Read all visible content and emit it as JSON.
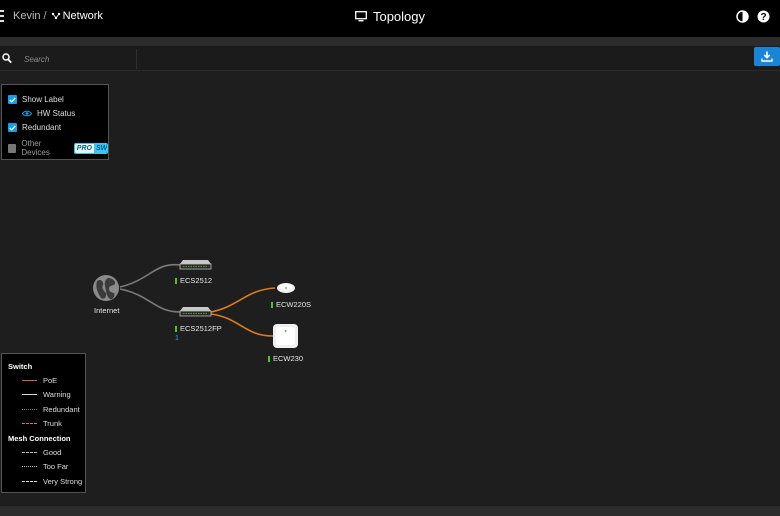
{
  "header": {
    "breadcrumb_site": "Kevin",
    "breadcrumb_separator": "/",
    "breadcrumb_network": "Network",
    "page_title": "Topology"
  },
  "search": {
    "placeholder": "Search"
  },
  "options": {
    "show_label": "Show Label",
    "hw_status": "HW Status",
    "redundant": "Redundant",
    "other_devices": "Other Devices",
    "badge_pro": "PRO",
    "badge_sw": "SW",
    "states": {
      "show_label": true,
      "redundant": true,
      "other_devices": false
    }
  },
  "legend": {
    "switch_title": "Switch",
    "poe": "PoE",
    "warning": "Warning",
    "redundant": "Redundant",
    "trunk": "Trunk",
    "mesh_title": "Mesh Connection",
    "good": "Good",
    "too_far": "Too Far",
    "very_strong": "Very Strong"
  },
  "devices": {
    "internet": "Internet",
    "switch1": "ECS2512",
    "switch2": "ECS2512FP",
    "switch2_ports": "1",
    "ap1": "ECW220S",
    "ap2": "ECW230"
  },
  "colors": {
    "accent": "#1a85d6",
    "poe": "#e05a2b",
    "trunk": "#e07b1a",
    "status_ok": "#54c02a",
    "link": "#7a7a7a"
  }
}
